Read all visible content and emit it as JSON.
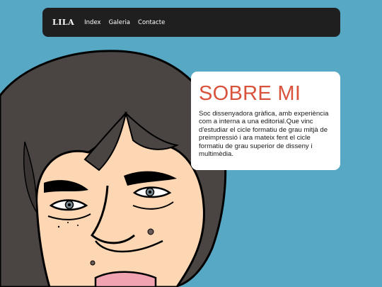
{
  "nav": {
    "brand": "LILA",
    "links": [
      {
        "label": "Index"
      },
      {
        "label": "Galeria"
      },
      {
        "label": "Contacte"
      }
    ]
  },
  "about": {
    "title": "SOBRE MI",
    "text": "Soc dissenyadora gràfica, amb experiència com a interna a una editorial.Que vinc d'estudiar el cicle formatiu de grau mitjà de preimpressió i ara mateix fent el cicle formatiu de grau superior de disseny i multimèdia."
  },
  "colors": {
    "background": "#56a8c5",
    "navbar": "#1f1f1f",
    "title_accent": "#d9533c",
    "hair": "#4a4442",
    "skin": "#fdd7b4"
  }
}
